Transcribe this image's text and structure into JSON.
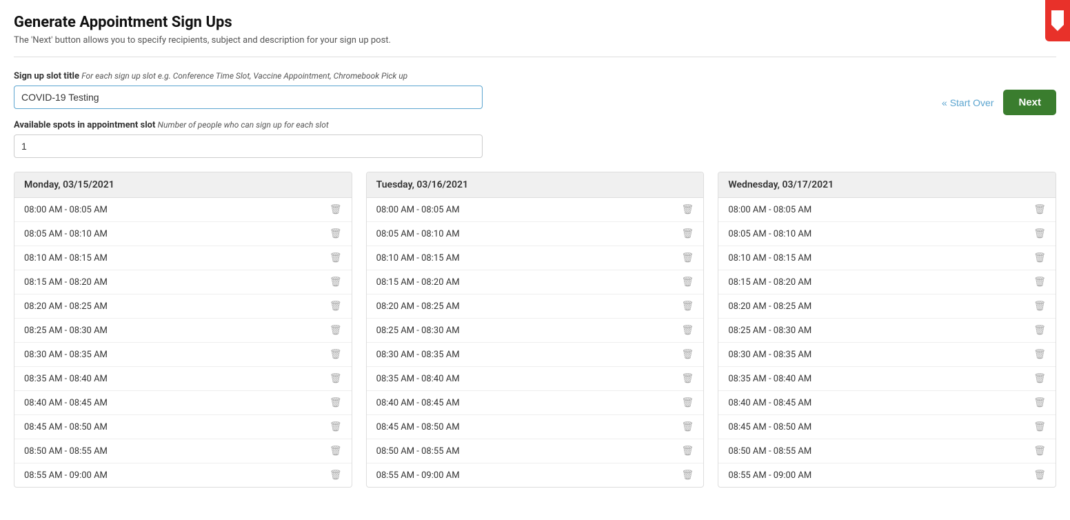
{
  "page": {
    "title": "Generate Appointment Sign Ups",
    "subtitle": "The 'Next' button allows you to specify recipients, subject and description for your sign up post."
  },
  "form": {
    "slot_title_label": "Sign up slot title",
    "slot_title_hint": "For each sign up slot e.g. Conference Time Slot, Vaccine Appointment, Chromebook Pick up",
    "slot_title_value": "COVID-19 Testing",
    "spots_label": "Available spots in appointment slot",
    "spots_hint": "Number of people who can sign up for each slot",
    "spots_value": "1"
  },
  "actions": {
    "start_over_label": "« Start Over",
    "next_label": "Next"
  },
  "days": [
    {
      "header": "Monday, 03/15/2021",
      "slots": [
        "08:00 AM - 08:05 AM",
        "08:05 AM - 08:10 AM",
        "08:10 AM - 08:15 AM",
        "08:15 AM - 08:20 AM",
        "08:20 AM - 08:25 AM",
        "08:25 AM - 08:30 AM",
        "08:30 AM - 08:35 AM",
        "08:35 AM - 08:40 AM",
        "08:40 AM - 08:45 AM",
        "08:45 AM - 08:50 AM",
        "08:50 AM - 08:55 AM",
        "08:55 AM - 09:00 AM"
      ]
    },
    {
      "header": "Tuesday, 03/16/2021",
      "slots": [
        "08:00 AM - 08:05 AM",
        "08:05 AM - 08:10 AM",
        "08:10 AM - 08:15 AM",
        "08:15 AM - 08:20 AM",
        "08:20 AM - 08:25 AM",
        "08:25 AM - 08:30 AM",
        "08:30 AM - 08:35 AM",
        "08:35 AM - 08:40 AM",
        "08:40 AM - 08:45 AM",
        "08:45 AM - 08:50 AM",
        "08:50 AM - 08:55 AM",
        "08:55 AM - 09:00 AM"
      ]
    },
    {
      "header": "Wednesday, 03/17/2021",
      "slots": [
        "08:00 AM - 08:05 AM",
        "08:05 AM - 08:10 AM",
        "08:10 AM - 08:15 AM",
        "08:15 AM - 08:20 AM",
        "08:20 AM - 08:25 AM",
        "08:25 AM - 08:30 AM",
        "08:30 AM - 08:35 AM",
        "08:35 AM - 08:40 AM",
        "08:40 AM - 08:45 AM",
        "08:45 AM - 08:50 AM",
        "08:50 AM - 08:55 AM",
        "08:55 AM - 09:00 AM"
      ]
    }
  ]
}
